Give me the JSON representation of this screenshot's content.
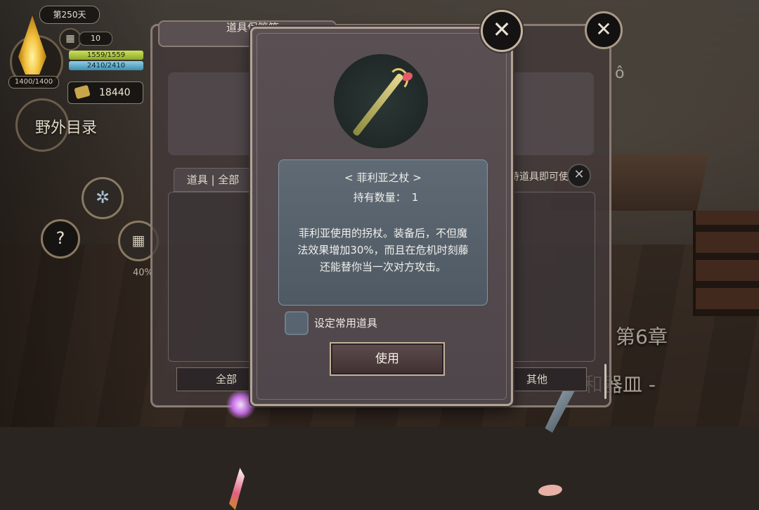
{
  "hud": {
    "day": "第250天",
    "calendar_value": "10",
    "hp": "1559/1559",
    "mp": "2410/2410",
    "stamina": "1400/1400",
    "gold": "18440",
    "field_directory": "野外目录",
    "progress_percent": "40%",
    "help_glyph": "?"
  },
  "scene": {
    "chapter_title": "第6章",
    "chapter_subtitle": "和器皿 -"
  },
  "storage_panel": {
    "title": "道具保管箱",
    "category_tab": "道具 | 全部",
    "hint": "持道具即可使用",
    "bottom_tabs": [
      "全部",
      "其他"
    ]
  },
  "item_dialog": {
    "item_name": "< 菲利亚之杖 >",
    "quantity_label": "持有数量：",
    "quantity_value": "1",
    "description": "菲利亚使用的拐杖。装备后，不但魔法效果增加30%，而且在危机时刻藤还能替你当一次对方攻击。",
    "set_common_label": "设定常用道具",
    "set_common_checked": false,
    "use_button": "使用"
  },
  "icons": {
    "close": "close-icon",
    "gear": "gear-icon",
    "calendar": "calendar-icon",
    "gold": "gold-icon",
    "help": "help-icon"
  },
  "colors": {
    "dialog_border": "#b4a494",
    "description_bg": "#5f6a74",
    "hp_bar": "#a9c33e",
    "mp_bar": "#5fb0cf"
  }
}
